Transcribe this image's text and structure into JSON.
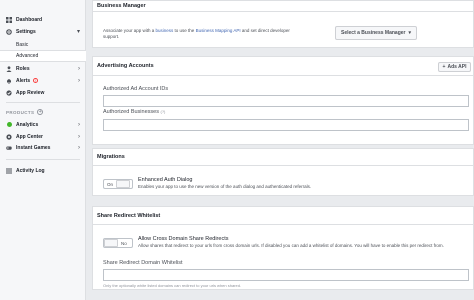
{
  "sidebar": {
    "dashboard": "Dashboard",
    "settings": "Settings",
    "basic": "Basic",
    "advanced": "Advanced",
    "roles": "Roles",
    "alerts": "Alerts",
    "alerts_badge": "!",
    "app_review": "App Review",
    "products_header": "PRODUCTS",
    "analytics": "Analytics",
    "app_center": "App Center",
    "instant_games": "Instant Games",
    "activity_log": "Activity Log"
  },
  "business_manager": {
    "title": "Business Manager",
    "desc_prefix": "Associate your app with a ",
    "desc_link1": "business",
    "desc_mid": " to use the ",
    "desc_link2": "Business Mapping API",
    "desc_suffix": " and set direct developer support.",
    "select_button": "Select a Business Manager",
    "select_caret": "▾"
  },
  "advertising": {
    "title": "Advertising Accounts",
    "add_button": "Ads API",
    "ad_ids_label": "Authorized Ad Account IDs",
    "ad_ids_value": "",
    "businesses_label": "Authorized Businesses",
    "businesses_info": "(?)",
    "businesses_value": ""
  },
  "migrations": {
    "title": "Migrations",
    "toggle_state": "On",
    "option_title": "Enhanced Auth Dialog",
    "option_desc": "Enables your app to use the new version of the auth dialog and authenticated referrals."
  },
  "share_redirect": {
    "title": "Share Redirect Whitelist",
    "toggle_state": "No",
    "option_title": "Allow Cross Domain Share Redirects",
    "option_desc": "Allow shares that redirect to your urls from cross domain urls. If disabled you can add a whitelist of domains. You will have to enable this per redirect from.",
    "whitelist_label": "Share Redirect Domain Whitelist",
    "whitelist_helper": "Only the optionally white listed domains can redirect to your urls when shared."
  }
}
